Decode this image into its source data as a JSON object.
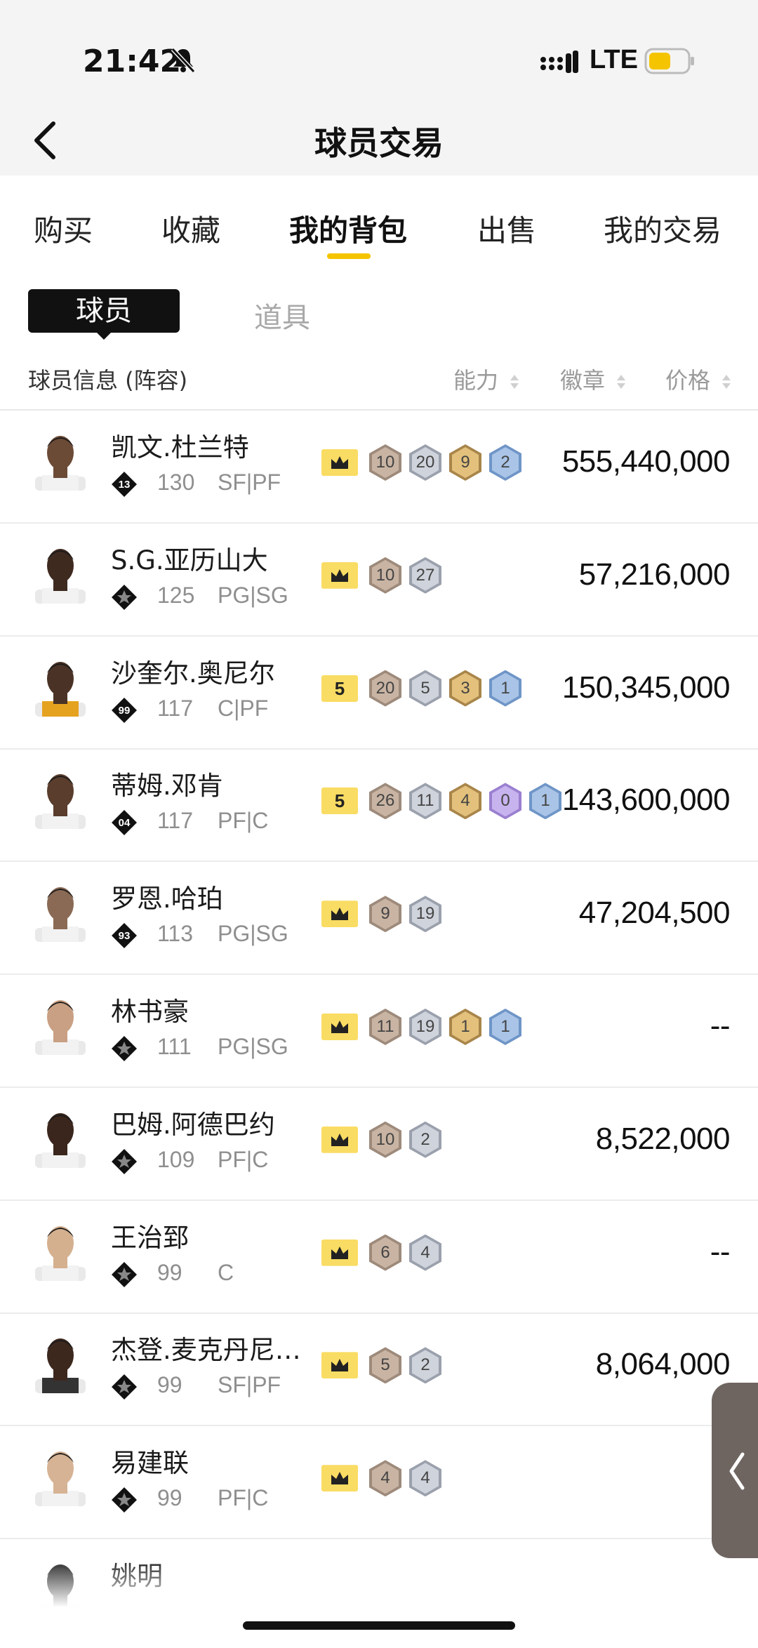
{
  "status_bar": {
    "time": "21:42",
    "network": "LTE"
  },
  "header": {
    "title": "球员交易"
  },
  "tabs": [
    {
      "label": "购买"
    },
    {
      "label": "收藏"
    },
    {
      "label": "我的背包"
    },
    {
      "label": "出售"
    },
    {
      "label": "我的交易"
    }
  ],
  "active_tab": "我的背包",
  "subtabs": {
    "active": "球员",
    "inactive": "道具"
  },
  "columns": {
    "info": "球员信息 (阵容)",
    "ability": "能力",
    "badge": "徽章",
    "price": "价格"
  },
  "colors": {
    "accent": "#f5c400",
    "badge_yellow": "#f9dc63"
  },
  "players": [
    {
      "name": "凯文.杜兰特",
      "rank": "13",
      "rating": "130",
      "position": "SF|PF",
      "badge_type": "crown",
      "badges": [
        {
          "v": "10",
          "t": "bronze"
        },
        {
          "v": "20",
          "t": "silver"
        },
        {
          "v": "9",
          "t": "gold"
        },
        {
          "v": "2",
          "t": "blue"
        }
      ],
      "price": "555,440,000"
    },
    {
      "name": "S.G.亚历山大",
      "rank": "",
      "rating": "125",
      "position": "PG|SG",
      "badge_type": "crown",
      "badges": [
        {
          "v": "10",
          "t": "bronze"
        },
        {
          "v": "27",
          "t": "silver"
        }
      ],
      "price": "57,216,000"
    },
    {
      "name": "沙奎尔.奥尼尔",
      "rank": "99",
      "rating": "117",
      "position": "C|PF",
      "badge_type": "5",
      "badges": [
        {
          "v": "20",
          "t": "bronze"
        },
        {
          "v": "5",
          "t": "silver"
        },
        {
          "v": "3",
          "t": "gold"
        },
        {
          "v": "1",
          "t": "blue"
        }
      ],
      "price": "150,345,000"
    },
    {
      "name": "蒂姆.邓肯",
      "rank": "04",
      "rating": "117",
      "position": "PF|C",
      "badge_type": "5",
      "badges": [
        {
          "v": "26",
          "t": "bronze"
        },
        {
          "v": "11",
          "t": "silver"
        },
        {
          "v": "4",
          "t": "gold"
        },
        {
          "v": "0",
          "t": "purple"
        },
        {
          "v": "1",
          "t": "blue"
        }
      ],
      "price": "143,600,000"
    },
    {
      "name": "罗恩.哈珀",
      "rank": "93",
      "rating": "113",
      "position": "PG|SG",
      "badge_type": "crown",
      "badges": [
        {
          "v": "9",
          "t": "bronze"
        },
        {
          "v": "19",
          "t": "silver"
        }
      ],
      "price": "47,204,500"
    },
    {
      "name": "林书豪",
      "rank": "",
      "rating": "111",
      "position": "PG|SG",
      "badge_type": "crown",
      "badges": [
        {
          "v": "11",
          "t": "bronze"
        },
        {
          "v": "19",
          "t": "silver"
        },
        {
          "v": "1",
          "t": "gold"
        },
        {
          "v": "1",
          "t": "blue"
        }
      ],
      "price": "--"
    },
    {
      "name": "巴姆.阿德巴约",
      "rank": "",
      "rating": "109",
      "position": "PF|C",
      "badge_type": "crown",
      "badges": [
        {
          "v": "10",
          "t": "bronze"
        },
        {
          "v": "2",
          "t": "silver"
        }
      ],
      "price": "8,522,000"
    },
    {
      "name": "王治郅",
      "rank": "",
      "rating": "99",
      "position": "C",
      "badge_type": "crown",
      "badges": [
        {
          "v": "6",
          "t": "bronze"
        },
        {
          "v": "4",
          "t": "silver"
        }
      ],
      "price": "--"
    },
    {
      "name": "杰登.麦克丹尼…",
      "rank": "",
      "rating": "99",
      "position": "SF|PF",
      "badge_type": "crown",
      "badges": [
        {
          "v": "5",
          "t": "bronze"
        },
        {
          "v": "2",
          "t": "silver"
        }
      ],
      "price": "8,064,000"
    },
    {
      "name": "易建联",
      "rank": "",
      "rating": "99",
      "position": "PF|C",
      "badge_type": "crown",
      "badges": [
        {
          "v": "4",
          "t": "bronze"
        },
        {
          "v": "4",
          "t": "silver"
        }
      ],
      "price": "-"
    },
    {
      "name": "姚明",
      "rank": "",
      "rating": "",
      "position": "",
      "badge_type": "",
      "badges": [],
      "price": ""
    }
  ]
}
